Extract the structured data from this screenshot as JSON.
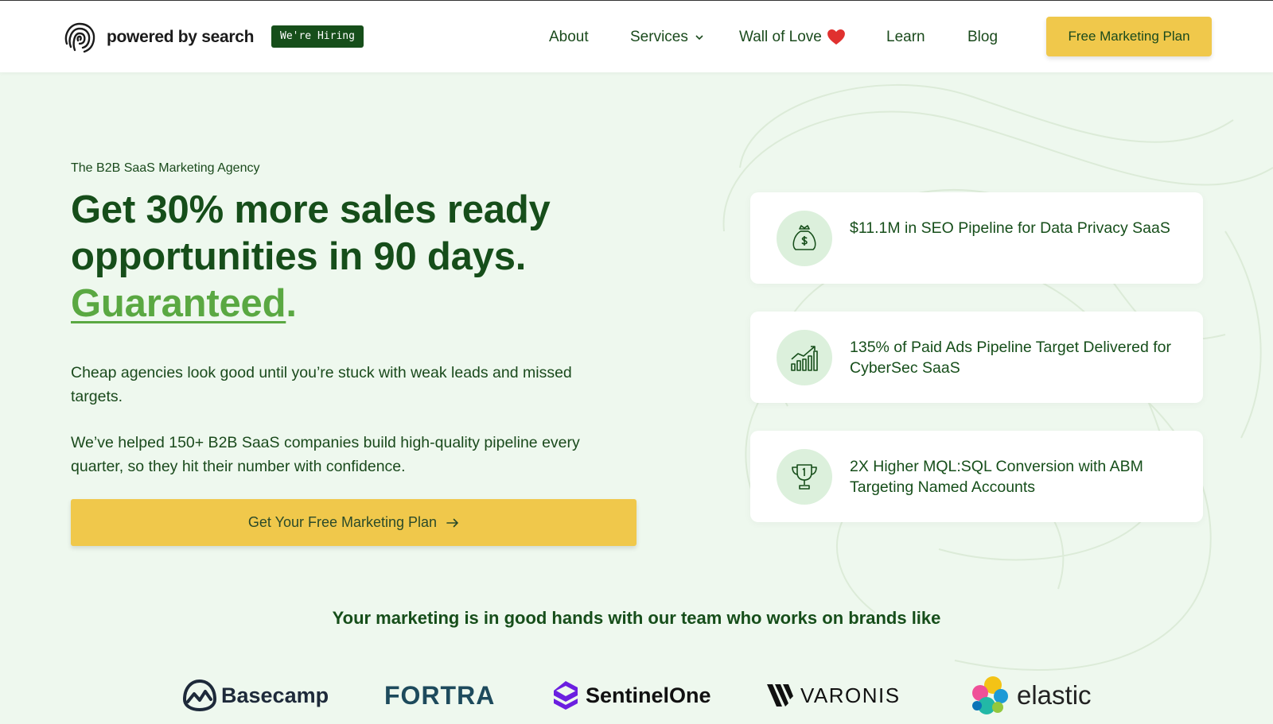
{
  "header": {
    "logo_text": "powered by search",
    "hiring_badge": "We're Hiring",
    "nav": {
      "about": "About",
      "services": "Services",
      "wall_of_love": "Wall of Love",
      "learn": "Learn",
      "blog": "Blog"
    },
    "cta": "Free Marketing Plan"
  },
  "hero": {
    "eyebrow": "The B2B SaaS Marketing Agency",
    "headline_line1": "Get 30% more sales ready",
    "headline_line2": "opportunities in 90 days.",
    "headline_highlight": "Guaranteed",
    "headline_period": ".",
    "paragraph1": "Cheap agencies look good until you’re stuck with weak leads and missed targets.",
    "paragraph2": "We’ve helped 150+ B2B SaaS companies build high-quality pipeline every quarter, so they hit their number with confidence.",
    "cta": "Get Your Free Marketing Plan"
  },
  "stats": [
    {
      "icon": "money-bag-icon",
      "text": "$11.1M in SEO Pipeline for Data Privacy SaaS"
    },
    {
      "icon": "growth-chart-icon",
      "text": "135% of Paid Ads Pipeline Target Delivered for CyberSec SaaS"
    },
    {
      "icon": "trophy-icon",
      "text": "2X Higher MQL:SQL Conversion with ABM Targeting Named Accounts"
    }
  ],
  "brands": {
    "title": "Your marketing is in good hands with our team who works on brands like",
    "logos": {
      "basecamp": "Basecamp",
      "fortra": "FORTRA",
      "sentinelone": "SentinelOne",
      "varonis": "VARONIS",
      "elastic": "elastic"
    }
  },
  "colors": {
    "primary_green": "#164e1a",
    "accent_green": "#5aa842",
    "cta_yellow": "#f0c84b",
    "background": "#eef8ee"
  }
}
